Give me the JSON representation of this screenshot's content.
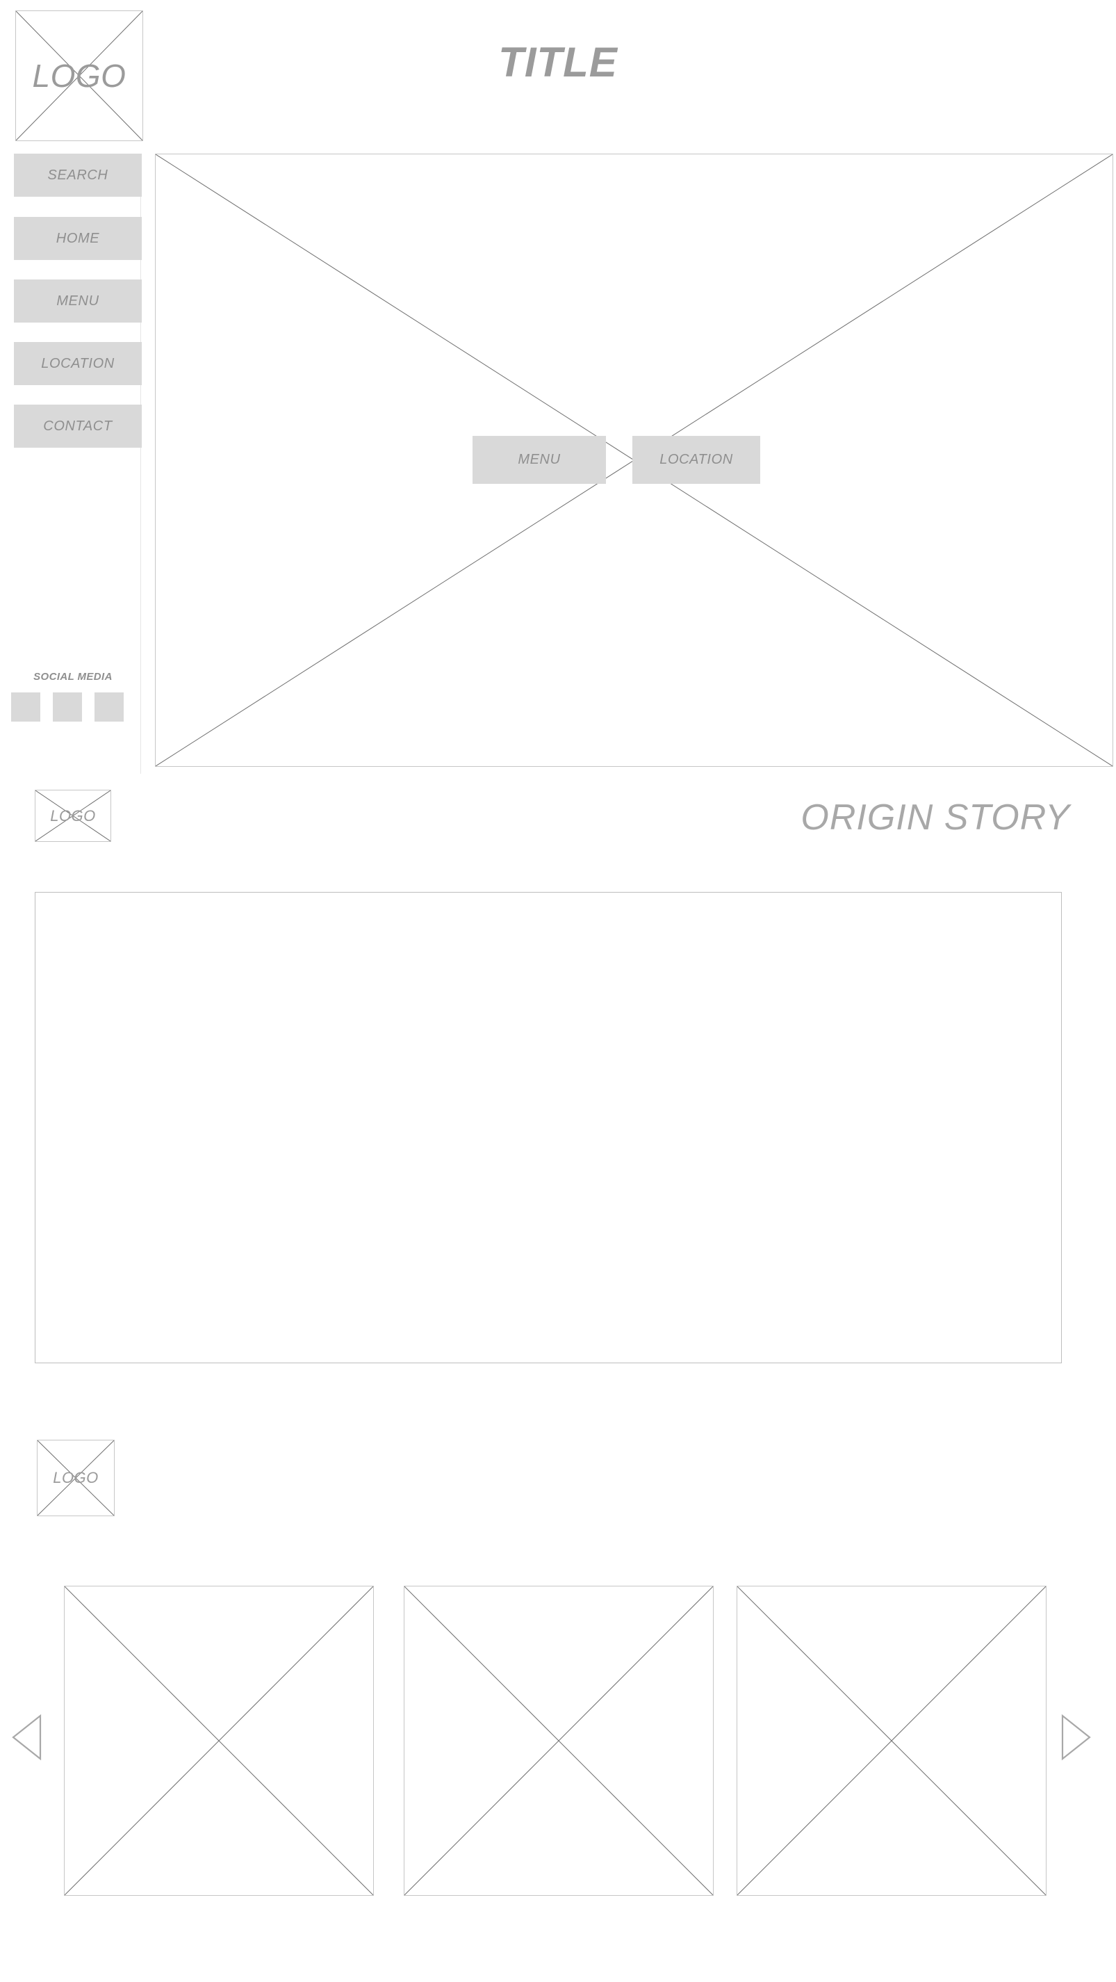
{
  "header": {
    "logo_label": "LOGO",
    "title": "TITLE"
  },
  "sidebar": {
    "nav_items": [
      {
        "label": "SEARCH"
      },
      {
        "label": "HOME"
      },
      {
        "label": "MENU"
      },
      {
        "label": "LOCATION"
      },
      {
        "label": "CONTACT"
      }
    ],
    "social": {
      "title": "SOCIAL MEDIA",
      "icons": [
        {
          "name": "social-icon-1"
        },
        {
          "name": "social-icon-2"
        },
        {
          "name": "social-icon-3"
        }
      ]
    }
  },
  "hero": {
    "image_placeholder": "",
    "cta_menu": "MENU",
    "cta_location": "LOCATION"
  },
  "origin_section": {
    "logo_label": "LOGO",
    "heading": "ORIGIN STORY",
    "body_text": ""
  },
  "gallery_section": {
    "logo_label": "LOGO",
    "items": [
      {
        "label": ""
      },
      {
        "label": ""
      },
      {
        "label": ""
      }
    ],
    "prev_icon": "triangle-left-icon",
    "next_icon": "triangle-right-icon"
  },
  "colors": {
    "placeholder_fill": "#d9d9d9",
    "text_gray": "#9b9b9b",
    "border_gray": "#c6c6c6",
    "cross_gray": "#6e6e6e",
    "background": "#ffffff"
  }
}
